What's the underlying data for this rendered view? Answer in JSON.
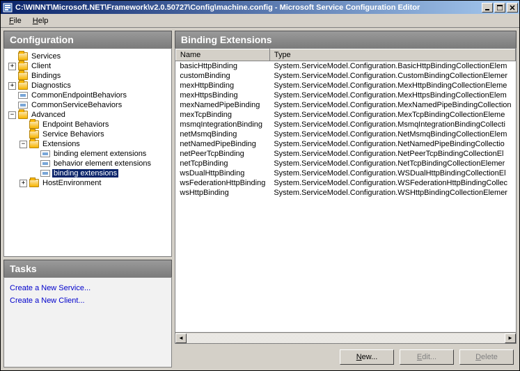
{
  "window": {
    "title": "C:\\WINNT\\Microsoft.NET\\Framework\\v2.0.50727\\Config\\machine.config - Microsoft Service Configuration Editor"
  },
  "menu": {
    "file": "File",
    "help": "Help"
  },
  "panels": {
    "config": "Configuration",
    "tasks": "Tasks",
    "right": "Binding Extensions"
  },
  "tree": {
    "services": "Services",
    "client": "Client",
    "bindings": "Bindings",
    "diagnostics": "Diagnostics",
    "commonEndpoint": "CommonEndpointBehaviors",
    "commonService": "CommonServiceBehaviors",
    "advanced": "Advanced",
    "endpointBehaviors": "Endpoint Behaviors",
    "serviceBehaviors": "Service Behaviors",
    "extensions": "Extensions",
    "bindingElementExt": "binding element extensions",
    "behaviorElementExt": "behavior element extensions",
    "bindingExt": "binding extensions",
    "hostEnv": "HostEnvironment"
  },
  "tasks": {
    "newService": "Create a New Service...",
    "newClient": "Create a New Client..."
  },
  "table": {
    "colName": "Name",
    "colType": "Type",
    "rows": [
      {
        "name": "basicHttpBinding",
        "type": "System.ServiceModel.Configuration.BasicHttpBindingCollectionElem"
      },
      {
        "name": "customBinding",
        "type": "System.ServiceModel.Configuration.CustomBindingCollectionElemer"
      },
      {
        "name": "mexHttpBinding",
        "type": "System.ServiceModel.Configuration.MexHttpBindingCollectionEleme"
      },
      {
        "name": "mexHttpsBinding",
        "type": "System.ServiceModel.Configuration.MexHttpsBindingCollectionElem"
      },
      {
        "name": "mexNamedPipeBinding",
        "type": "System.ServiceModel.Configuration.MexNamedPipeBindingCollection"
      },
      {
        "name": "mexTcpBinding",
        "type": "System.ServiceModel.Configuration.MexTcpBindingCollectionEleme"
      },
      {
        "name": "msmqIntegrationBinding",
        "type": "System.ServiceModel.Configuration.MsmqIntegrationBindingCollecti"
      },
      {
        "name": "netMsmqBinding",
        "type": "System.ServiceModel.Configuration.NetMsmqBindingCollectionElem"
      },
      {
        "name": "netNamedPipeBinding",
        "type": "System.ServiceModel.Configuration.NetNamedPipeBindingCollectio"
      },
      {
        "name": "netPeerTcpBinding",
        "type": "System.ServiceModel.Configuration.NetPeerTcpBindingCollectionEl"
      },
      {
        "name": "netTcpBinding",
        "type": "System.ServiceModel.Configuration.NetTcpBindingCollectionElemer"
      },
      {
        "name": "wsDualHttpBinding",
        "type": "System.ServiceModel.Configuration.WSDualHttpBindingCollectionEl"
      },
      {
        "name": "wsFederationHttpBinding",
        "type": "System.ServiceModel.Configuration.WSFederationHttpBindingCollec"
      },
      {
        "name": "wsHttpBinding",
        "type": "System.ServiceModel.Configuration.WSHttpBindingCollectionElemer"
      }
    ]
  },
  "buttons": {
    "new": "New...",
    "edit": "Edit...",
    "delete": "Delete"
  }
}
